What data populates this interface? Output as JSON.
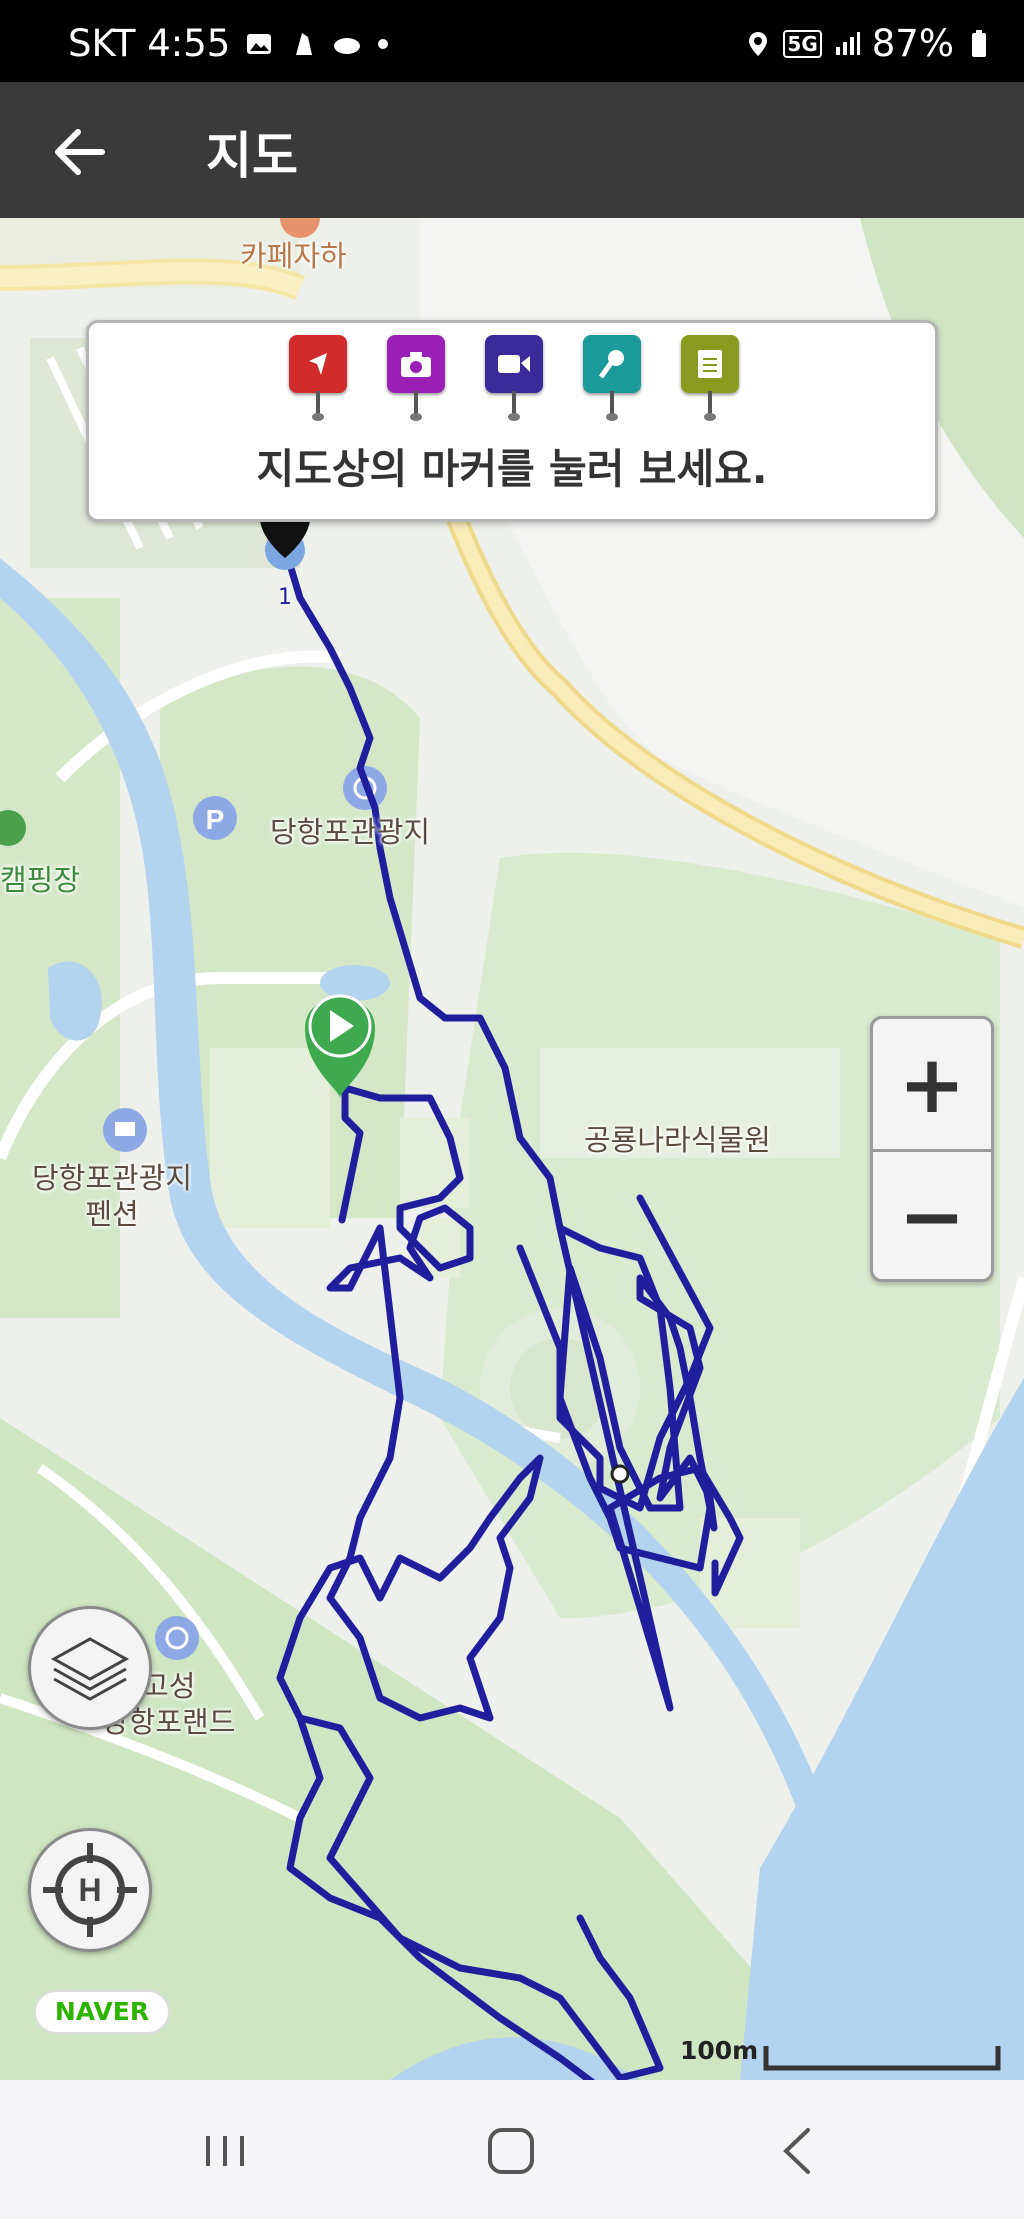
{
  "status_bar": {
    "carrier_time": "SKT 4:55",
    "network": "5G",
    "battery": "87%"
  },
  "app_bar": {
    "title": "지도",
    "back_icon": "arrow-left-icon"
  },
  "legend": {
    "markers": [
      {
        "name": "start-marker-icon",
        "color": "#d12b2b"
      },
      {
        "name": "camera-marker-icon",
        "color": "#9b1fb5"
      },
      {
        "name": "video-marker-icon",
        "color": "#3a2a9a"
      },
      {
        "name": "voice-marker-icon",
        "color": "#1a9a9a"
      },
      {
        "name": "memo-marker-icon",
        "color": "#8a9a1f"
      }
    ],
    "instruction": "지도상의 마커를 눌러 보세요."
  },
  "map": {
    "labels": {
      "cafe": "카페자하",
      "park": "당항포관광지",
      "camping": "캠핑장",
      "pension": "당항포관광지\n펜션",
      "garden": "공룡나라식물원",
      "land": "고성\n당항포랜드"
    },
    "start_number": "1",
    "track_color": "#1f1f9e",
    "brand": "NAVER",
    "scale": "100m"
  },
  "controls": {
    "zoom_in": "+",
    "zoom_out": "−",
    "layers_icon": "layers-icon",
    "location_icon": "crosshair-h-icon"
  },
  "nav_bar": {
    "recent_icon": "recents-icon",
    "home_icon": "home-icon",
    "back_icon": "back-chevron-icon"
  }
}
